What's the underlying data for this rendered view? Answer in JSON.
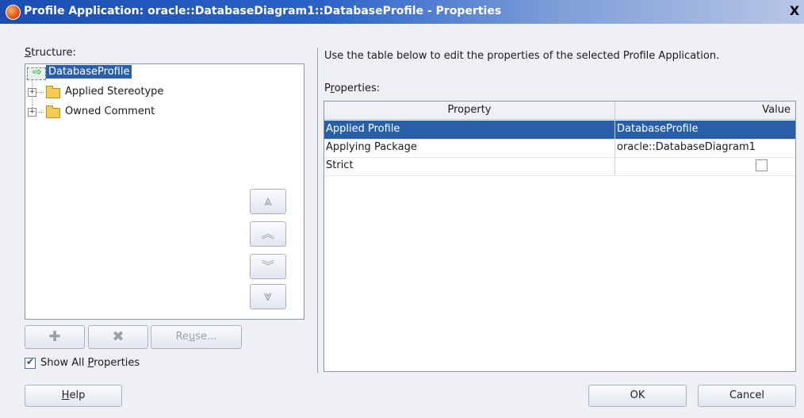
{
  "window": {
    "title": "Profile Application: oracle::DatabaseDiagram1::DatabaseProfile - Properties",
    "close_glyph": "X"
  },
  "structure": {
    "label_prefix": "S",
    "label_rest": "tructure:",
    "root": "DatabaseProfile",
    "children": [
      "Applied Stereotype",
      "Owned Comment"
    ]
  },
  "reorder_buttons": {
    "top": "⩓",
    "up": "︽",
    "down": "︾",
    "bottom": "⩔"
  },
  "tree_actions": {
    "add": "✚",
    "remove": "✖",
    "reuse_pre": "Re",
    "reuse_u": "u",
    "reuse_post": "se..."
  },
  "show_all": {
    "pre": "Show All ",
    "u": "P",
    "post": "roperties",
    "checked": true
  },
  "instructions": "Use the table below to edit the properties of the selected Profile Application.",
  "properties": {
    "label_pre": "P",
    "label_u": "r",
    "label_post": "operties:",
    "columns": [
      "Property",
      "Value"
    ],
    "rows": [
      {
        "property": "Applied Profile",
        "value": "DatabaseProfile",
        "selected": true
      },
      {
        "property": "Applying Package",
        "value": "oracle::DatabaseDiagram1",
        "selected": false
      },
      {
        "property": "Strict",
        "value": "",
        "checkbox": true,
        "selected": false
      }
    ]
  },
  "footer": {
    "help_u": "H",
    "help_rest": "elp",
    "ok": "OK",
    "cancel": "Cancel"
  },
  "colors": {
    "selection": "#2a5fa8",
    "title_bar": "#1b4eb1"
  }
}
